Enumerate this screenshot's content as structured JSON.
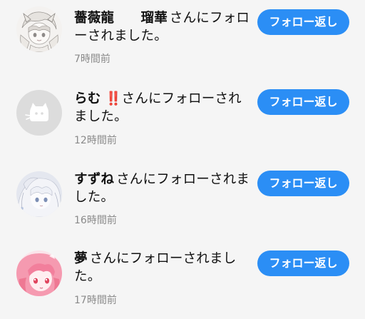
{
  "notifications": [
    {
      "username": "薔薇龍　　瑠華",
      "emoji": "",
      "message_suffix": "さんにフォローされました。",
      "time": "7時間前",
      "button_label": "フォロー返し",
      "avatar_icon": "anime-girl-sketch-avatar"
    },
    {
      "username": "らむ",
      "emoji": "‼️",
      "message_suffix": "さんにフォローされました。",
      "time": "12時間前",
      "button_label": "フォロー返し",
      "avatar_icon": "default-cat-avatar"
    },
    {
      "username": "すずね",
      "emoji": "",
      "message_suffix": "さんにフォローされました。",
      "time": "16時間前",
      "button_label": "フォロー返し",
      "avatar_icon": "anime-girl-white-hair-avatar"
    },
    {
      "username": "夢",
      "emoji": "",
      "message_suffix": "さんにフォローされました。",
      "time": "17時間前",
      "button_label": "フォロー返し",
      "avatar_icon": "anime-girl-pink-hair-avatar"
    }
  ],
  "colors": {
    "background": "#f5f5f5",
    "button": "#2b8ef5",
    "time_text": "#8a8a8a",
    "emoji_red": "#e8202a"
  }
}
